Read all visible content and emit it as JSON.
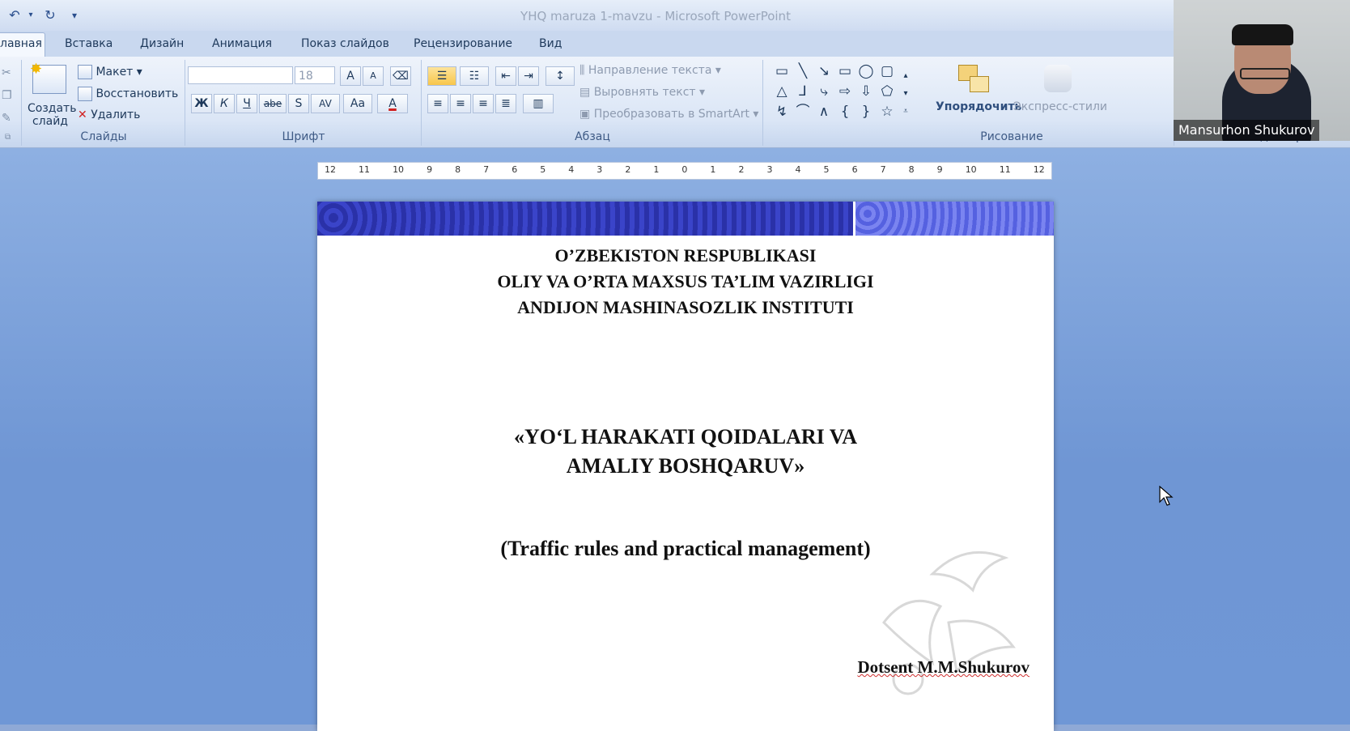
{
  "window": {
    "title": "YHQ maruza 1-mavzu  -  Microsoft PowerPoint"
  },
  "quick_access": {
    "undo_icon": "undo-icon",
    "redo_icon": "redo-icon",
    "customize_icon": "qat-dropdown-icon"
  },
  "tabs": [
    {
      "label": "лавная"
    },
    {
      "label": "Вставка"
    },
    {
      "label": "Дизайн"
    },
    {
      "label": "Анимация"
    },
    {
      "label": "Показ слайдов"
    },
    {
      "label": "Рецензирование"
    },
    {
      "label": "Вид"
    }
  ],
  "ribbon": {
    "slides": {
      "group_label": "Слайды",
      "new_slide": "Создать слайд",
      "layout": "Макет",
      "reset": "Восстановить",
      "delete": "Удалить"
    },
    "font": {
      "group_label": "Шрифт",
      "font_name": "",
      "font_size": "18",
      "bold": "Ж",
      "italic": "К",
      "underline": "Ч",
      "strike": "abe",
      "shadow": "S",
      "spacing": "AV",
      "case": "Aa",
      "color": "A",
      "grow": "A",
      "shrink": "A"
    },
    "paragraph": {
      "group_label": "Абзац",
      "text_direction": "Направление текста",
      "align_text": "Выровнять текст",
      "smartart": "Преобразовать в SmartArt"
    },
    "drawing": {
      "group_label": "Рисование",
      "arrange": "Упорядочить",
      "quick_styles": "Экспресс-стили"
    },
    "editing": {
      "group_label": "Редактировани"
    }
  },
  "ruler": {
    "ticks": [
      "12",
      "11",
      "10",
      "9",
      "8",
      "7",
      "6",
      "5",
      "4",
      "3",
      "2",
      "1",
      "0",
      "1",
      "2",
      "3",
      "4",
      "5",
      "6",
      "7",
      "8",
      "9",
      "10",
      "11",
      "12"
    ]
  },
  "slide": {
    "heading_lines": [
      "O’ZBEKISTON RESPUBLIKASI",
      "OLIY VA O’RTA MAXSUS TA’LIM VAZIRLIGI",
      "ANDIJON MASHINASOZLIK INSTITUTI"
    ],
    "title_lines": [
      "«YO‘L HARAKATI QOIDALARI VA",
      "AMALIY BOSHQARUV»"
    ],
    "subtitle": "(Traffic rules and practical management)",
    "author": "Dotsent M.M.Shukurov"
  },
  "webcam": {
    "participant_name": "Mansurhon Shukurov"
  },
  "colors": {
    "ribbon_bg": "#dbe6f6",
    "workspace_bg": "#7a9fd9",
    "banner_dark": "#2a31a8",
    "banner_light": "#6b76ea"
  }
}
